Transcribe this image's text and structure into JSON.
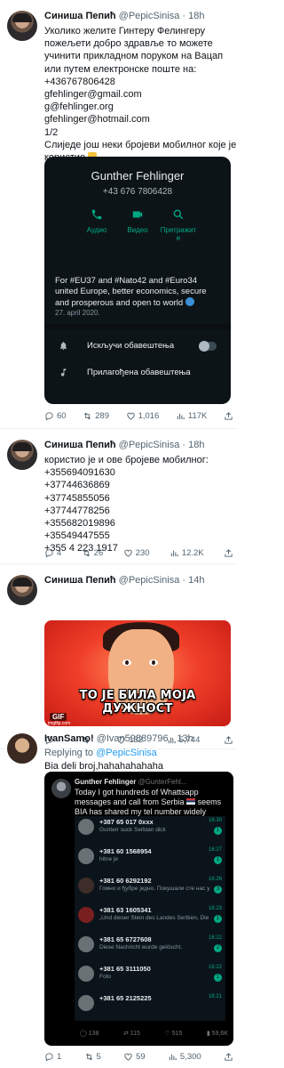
{
  "colors": {
    "text_primary": "#0f1419",
    "text_secondary": "#536471",
    "link": "#1d9bf0",
    "whatsapp_green": "#00a884",
    "whatsapp_bg": "#0d1418",
    "meme_red": "#e0301e"
  },
  "tweets": [
    {
      "name": "Синиша Пепић",
      "handle_time": "@PepicSinisa · 18h",
      "lines": [
        "Уколико желите Гинтеру Фелингеру",
        "пожељети добро здравље то можете",
        "учинити прикладном поруком на Вацап",
        "или путем електронске поште на:",
        "+436767806428",
        "gfehlinger@gmail.com",
        "g@fehlinger.org",
        "gfehlinger@hotmail.com",
        "1/2",
        "Слиједе још неки бројеви мобилног које је",
        "користио"
      ],
      "card": {
        "contact_name": "Gunther Fehlinger",
        "contact_number": "+43 676 7806428",
        "btn_audio": "Аудио",
        "btn_video": "Видео",
        "btn_search_1": "Претражит",
        "btn_search_2": "е",
        "bio_1": "For #EU37 and #Nato42 and #Euro34",
        "bio_2": "united Europe, better economics, secure",
        "bio_3": "and prosperous and open to world",
        "date": "27. april 2020.",
        "row_mute": "Искључи обавештења",
        "row_custom": "Прилагођена обавештења"
      },
      "actions": {
        "replies": "60",
        "retweets": "289",
        "likes": "1,016",
        "views": "117K"
      }
    },
    {
      "name": "Синиша Пепић",
      "handle_time": "@PepicSinisa · 18h",
      "lines": [
        "користио је и ове бројеве мобилног:",
        "+355694091630",
        "+37744636869",
        "+37745855056",
        "+37744778256",
        "+355682019896",
        "+35549447555",
        "+355 4 223 1917"
      ],
      "actions": {
        "replies": "4",
        "retweets": "26",
        "likes": "230",
        "views": "12.2K"
      }
    },
    {
      "name": "Синиша Пепић",
      "handle_time": "@PepicSinisa · 14h",
      "meme": {
        "caption": "ТО ЈЕ БИЛА МОЈА ДУЖНОСТ",
        "gif_label": "GIF",
        "watermark": "imgflip.com"
      },
      "actions": {
        "replies": "",
        "retweets": "",
        "likes": "132",
        "views": "5,744"
      }
    },
    {
      "name": "IvanSamo!",
      "handle_time": "@Ivan59889796 · 13h",
      "replying_label": "Replying to",
      "replying_handle": "@PepicSinisa",
      "text": "Bia deli broj,hahahahahaha",
      "screenshot": {
        "name": "Gunther Fehlinger",
        "handle": "@GunterFehl...",
        "line_1": "Today I got hundreds of Whattsapp",
        "line_2": "messages and call from Serbia",
        "line_2b": "seems",
        "line_3": "BIA has shared my tel number widely",
        "chats": [
          {
            "number": "+387 65 017 0xxx",
            "msg": "Gunterr suck Serbian dick",
            "time": "16:30",
            "badge": "1"
          },
          {
            "number": "+381 60 1568954",
            "msg": "hitne je",
            "time": "16:27",
            "badge": "1"
          },
          {
            "number": "+381 60 6292192",
            "msg": "Гомно и ђубре једно. Покушали сте нас уништити и покорити",
            "time": "16:26",
            "badge": "3"
          },
          {
            "number": "+381 63 1605341",
            "msg": "„Und dieser Stein des Landes Serbien, Die durch die Wolke die",
            "time": "16:23",
            "badge": "1"
          },
          {
            "number": "+381 65 6727608",
            "msg": "Diese Nachricht wurde gelöscht.",
            "time": "16:22",
            "badge": "2"
          },
          {
            "number": "+381 65 3111050",
            "msg": "Foto",
            "time": "16:22",
            "badge": "1"
          },
          {
            "number": "+381 65 2125225",
            "msg": "",
            "time": "16:21",
            "badge": ""
          }
        ],
        "acts": {
          "replies": "138",
          "retweets": "115",
          "likes": "515",
          "views": "59,6K"
        }
      },
      "actions": {
        "replies": "1",
        "retweets": "5",
        "likes": "59",
        "views": "5,300"
      }
    }
  ]
}
